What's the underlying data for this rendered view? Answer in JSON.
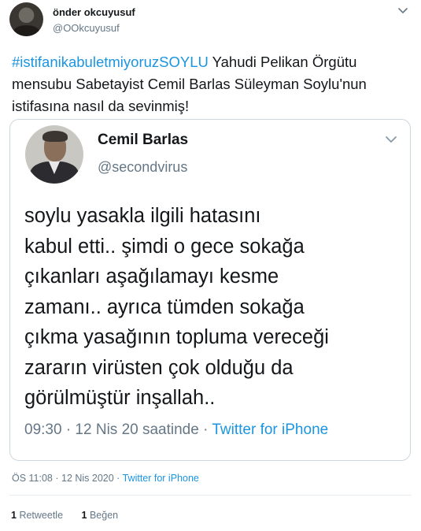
{
  "author": {
    "name": "önder okcuyusuf",
    "handle": "@OOkcuyusuf"
  },
  "tweet": {
    "hashtag": "#istifanikabuletmiyoruzSOYLU",
    "text": " Yahudi Pelikan Örgütu mensubu Sabetayist Cemil Barlas Süleyman Soylu'nun istifasına nasıl da sevinmiş!"
  },
  "quoted": {
    "name": "Cemil Barlas",
    "handle": "@secondvirus",
    "text": "soylu yasakla ilgili hatasını\nkabul etti.. şimdi o gece sokağa\nçıkanları aşağılamayı kesme\nzamanı..  ayrıca tümden sokağa\nçıkma yasağının topluma vereceği\nzararın virüsten çok olduğu da\ngörülmüştür inşallah..",
    "time": "09:30 · 12 Nis 20 saatinde · ",
    "source": "Twitter for iPhone"
  },
  "timestamp": {
    "time": "ÖS 11:08 · 12 Nis 2020 · ",
    "source": "Twitter for iPhone"
  },
  "stats": {
    "retweets_count": "1",
    "retweets_label": "Retweetle",
    "likes_count": "1",
    "likes_label": "Beğen"
  },
  "colors": {
    "link": "#1b95e0",
    "secondary_text": "#657786",
    "border": "#ccd6dd"
  },
  "icons": {
    "menu": "chevron-down-icon"
  }
}
